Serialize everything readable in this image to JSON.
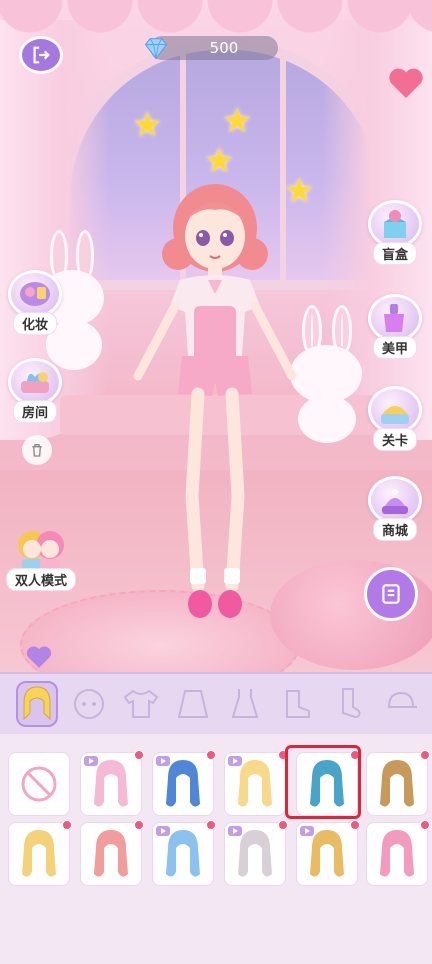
{
  "header": {
    "currency_amount": "500",
    "currency_icon": "diamond-icon",
    "exit_icon": "exit-icon"
  },
  "left_menu": [
    {
      "id": "makeup",
      "label": "化妆",
      "icon": "makeup-palette-icon"
    },
    {
      "id": "room",
      "label": "房间",
      "icon": "room-icon"
    },
    {
      "id": "duo",
      "label": "双人模式",
      "icon": "duo-mode-icon"
    }
  ],
  "right_menu": [
    {
      "id": "blindbox",
      "label": "盲盒",
      "icon": "blind-box-icon"
    },
    {
      "id": "nails",
      "label": "美甲",
      "icon": "nail-polish-icon"
    },
    {
      "id": "levels",
      "label": "关卡",
      "icon": "levels-icon"
    },
    {
      "id": "shop",
      "label": "商城",
      "icon": "shop-icon"
    }
  ],
  "categories": [
    {
      "id": "hair",
      "icon": "hair-icon",
      "active": true
    },
    {
      "id": "face",
      "icon": "face-icon",
      "active": false
    },
    {
      "id": "top",
      "icon": "tshirt-icon",
      "active": false
    },
    {
      "id": "skirt",
      "icon": "skirt-icon",
      "active": false
    },
    {
      "id": "dress",
      "icon": "dress-icon",
      "active": false
    },
    {
      "id": "shoes",
      "icon": "boot-icon",
      "active": false
    },
    {
      "id": "socks",
      "icon": "sock-icon",
      "active": false
    },
    {
      "id": "hat",
      "icon": "cap-icon",
      "active": false
    }
  ],
  "items": [
    {
      "kind": "none",
      "color": "#f2a6bf",
      "video": false,
      "dot": false
    },
    {
      "kind": "hair",
      "color": "#f5b9d6",
      "video": true,
      "dot": true
    },
    {
      "kind": "hair",
      "color": "#4f86d6",
      "video": true,
      "dot": true
    },
    {
      "kind": "hair",
      "color": "#f6d98b",
      "video": true,
      "dot": true
    },
    {
      "kind": "hair",
      "color": "#4aa3c9",
      "video": false,
      "dot": true,
      "selected": true
    },
    {
      "kind": "hair",
      "color": "#c79a5b",
      "video": false,
      "dot": true
    },
    {
      "kind": "hair",
      "color": "#f4d27a",
      "video": false,
      "dot": true
    },
    {
      "kind": "hair",
      "color": "#f29c9c",
      "video": false,
      "dot": true
    },
    {
      "kind": "hair",
      "color": "#8cc3ee",
      "video": true,
      "dot": true
    },
    {
      "kind": "hair",
      "color": "#d8d0d6",
      "video": true,
      "dot": true
    },
    {
      "kind": "hair",
      "color": "#e9bb63",
      "video": true,
      "dot": true
    },
    {
      "kind": "hair",
      "color": "#f39abf",
      "video": false,
      "dot": true
    }
  ],
  "colors": {
    "accent_purple": "#a577e0",
    "selection_red": "#e02636",
    "new_dot": "#f0587d"
  }
}
